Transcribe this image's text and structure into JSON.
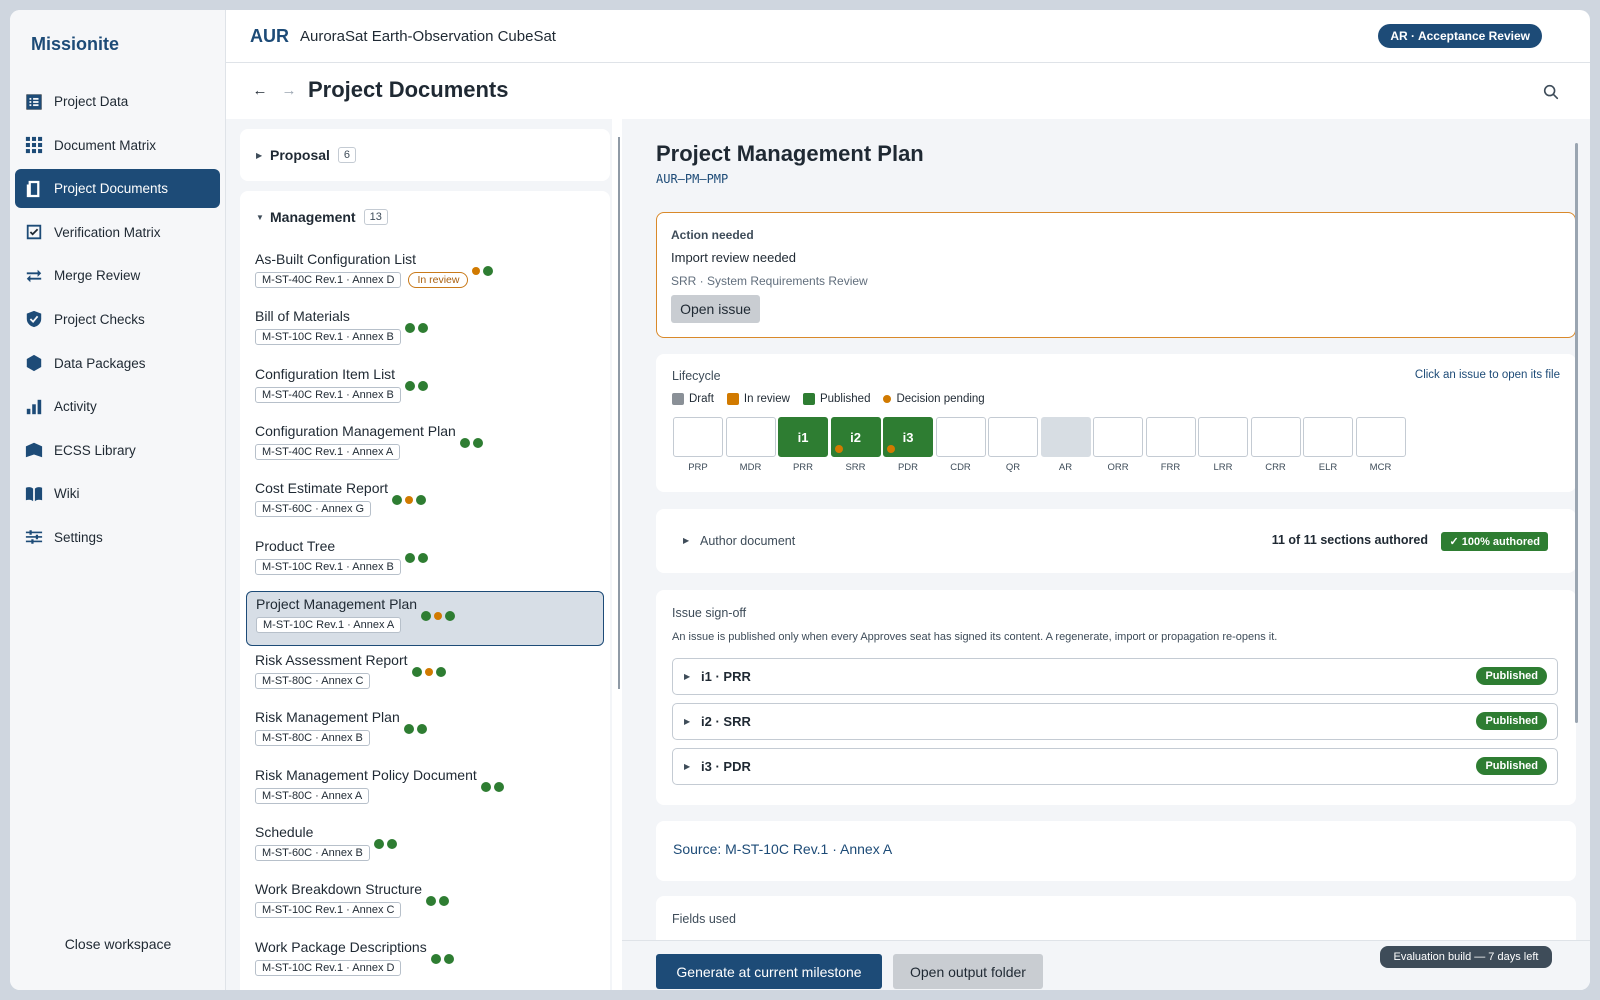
{
  "app": {
    "brand": "Missionite",
    "close_workspace": "Close workspace",
    "eval_badge": "Evaluation build — 7 days left"
  },
  "sidebar": {
    "items": [
      {
        "label": "Project Data",
        "icon": "list-icon"
      },
      {
        "label": "Document Matrix",
        "icon": "grid-icon"
      },
      {
        "label": "Project Documents",
        "icon": "document-icon",
        "active": true
      },
      {
        "label": "Verification Matrix",
        "icon": "checkbox-icon"
      },
      {
        "label": "Merge Review",
        "icon": "swap-arrows-icon"
      },
      {
        "label": "Project Checks",
        "icon": "shield-check-icon"
      },
      {
        "label": "Data Packages",
        "icon": "hexagon-icon"
      },
      {
        "label": "Activity",
        "icon": "bar-chart-icon"
      },
      {
        "label": "ECSS Library",
        "icon": "bank-icon"
      },
      {
        "label": "Wiki",
        "icon": "book-icon"
      },
      {
        "label": "Settings",
        "icon": "sliders-icon"
      }
    ]
  },
  "header": {
    "project_code": "AUR",
    "project_name": "AuroraSat Earth-Observation CubeSat",
    "milestone": "AR · Acceptance Review"
  },
  "page": {
    "title": "Project Documents"
  },
  "doc_groups": {
    "proposal": {
      "title": "Proposal",
      "count": "6"
    },
    "management": {
      "title": "Management",
      "count": "13"
    }
  },
  "documents": [
    {
      "name": "As-Built Configuration List",
      "std": "M-ST-40C Rev.1 · Annex D",
      "tag": "In review",
      "dots": [
        "orange",
        "green"
      ]
    },
    {
      "name": "Bill of Materials",
      "std": "M-ST-10C Rev.1 · Annex B",
      "dots": [
        "green",
        "green"
      ]
    },
    {
      "name": "Configuration Item List",
      "std": "M-ST-40C Rev.1 · Annex B",
      "dots": [
        "green",
        "green"
      ]
    },
    {
      "name": "Configuration Management Plan",
      "std": "M-ST-40C Rev.1 · Annex A",
      "dots": [
        "green",
        "green"
      ]
    },
    {
      "name": "Cost Estimate Report",
      "std": "M-ST-60C · Annex G",
      "dots": [
        "green",
        "orange",
        "green"
      ]
    },
    {
      "name": "Product Tree",
      "std": "M-ST-10C Rev.1 · Annex B",
      "dots": [
        "green",
        "green"
      ]
    },
    {
      "name": "Project Management Plan",
      "std": "M-ST-10C Rev.1 · Annex A",
      "dots": [
        "green",
        "orange",
        "green"
      ],
      "selected": true
    },
    {
      "name": "Risk Assessment Report",
      "std": "M-ST-80C · Annex C",
      "dots": [
        "green",
        "orange",
        "green"
      ]
    },
    {
      "name": "Risk Management Plan",
      "std": "M-ST-80C · Annex B",
      "dots": [
        "green",
        "green"
      ]
    },
    {
      "name": "Risk Management Policy Document",
      "std": "M-ST-80C · Annex A",
      "dots": [
        "green",
        "green"
      ]
    },
    {
      "name": "Schedule",
      "std": "M-ST-60C · Annex B",
      "dots": [
        "green",
        "green"
      ]
    },
    {
      "name": "Work Breakdown Structure",
      "std": "M-ST-10C Rev.1 · Annex C",
      "dots": [
        "green",
        "green"
      ]
    },
    {
      "name": "Work Package Descriptions",
      "std": "M-ST-10C Rev.1 · Annex D",
      "dots": [
        "green",
        "green"
      ]
    }
  ],
  "detail": {
    "title": "Project Management Plan",
    "code": "AUR–PM–PMP",
    "action": {
      "heading": "Action needed",
      "message": "Import review needed",
      "sub": "SRR · System Requirements Review",
      "button": "Open issue"
    },
    "lifecycle": {
      "title": "Lifecycle",
      "hint": "Click an issue to open its file",
      "legend": [
        {
          "label": "Draft",
          "color": "#8a9097",
          "shape": "square"
        },
        {
          "label": "In review",
          "color": "#d17a00",
          "shape": "square"
        },
        {
          "label": "Published",
          "color": "#2e7d32",
          "shape": "square"
        },
        {
          "label": "Decision pending",
          "color": "#d17a00",
          "shape": "dot"
        }
      ],
      "milestones": [
        {
          "code": "PRP",
          "issue": "",
          "state": "empty"
        },
        {
          "code": "MDR",
          "issue": "",
          "state": "empty"
        },
        {
          "code": "PRR",
          "issue": "i1",
          "state": "published"
        },
        {
          "code": "SRR",
          "issue": "i2",
          "state": "published",
          "pending": true
        },
        {
          "code": "PDR",
          "issue": "i3",
          "state": "published",
          "pending": true
        },
        {
          "code": "CDR",
          "issue": "",
          "state": "empty"
        },
        {
          "code": "QR",
          "issue": "",
          "state": "empty"
        },
        {
          "code": "AR",
          "issue": "",
          "state": "current"
        },
        {
          "code": "ORR",
          "issue": "",
          "state": "empty"
        },
        {
          "code": "FRR",
          "issue": "",
          "state": "empty"
        },
        {
          "code": "LRR",
          "issue": "",
          "state": "empty"
        },
        {
          "code": "CRR",
          "issue": "",
          "state": "empty"
        },
        {
          "code": "ELR",
          "issue": "",
          "state": "empty"
        },
        {
          "code": "MCR",
          "issue": "",
          "state": "empty"
        }
      ]
    },
    "author": {
      "label": "Author document",
      "count": "11 of 11 sections authored",
      "badge": "✓ 100% authored"
    },
    "signoff": {
      "title": "Issue sign-off",
      "desc": "An issue is published only when every Approves seat has signed its content. A regenerate, import or propagation re-opens it.",
      "issues": [
        {
          "label": "i1 · PRR",
          "status": "Published"
        },
        {
          "label": "i2 · SRR",
          "status": "Published"
        },
        {
          "label": "i3 · PDR",
          "status": "Published"
        }
      ]
    },
    "source": "Source: M-ST-10C Rev.1 · Annex A",
    "fields_used": "Fields used",
    "buttons": {
      "generate": "Generate at current milestone",
      "open_output": "Open output folder"
    }
  }
}
